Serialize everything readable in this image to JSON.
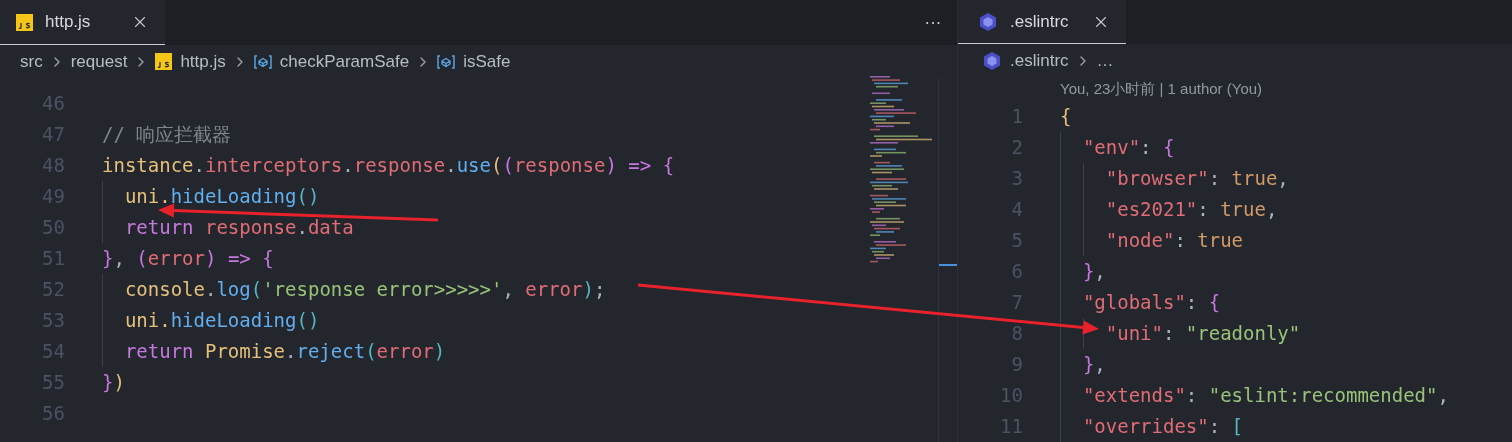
{
  "editors": [
    {
      "tab": {
        "label": "http.js",
        "selected": true
      },
      "more": "···",
      "breadcrumb": [
        {
          "kind": "folder",
          "label": "src"
        },
        {
          "kind": "folder",
          "label": "request"
        },
        {
          "kind": "file",
          "label": "http.js"
        },
        {
          "kind": "symbol",
          "label": "checkParamSafe"
        },
        {
          "kind": "symbol",
          "label": "isSafe"
        }
      ],
      "lines": [
        {
          "number": "46"
        },
        {
          "number": "47",
          "tokens": [
            {
              "kind": "cmt",
              "text": "// 响应拦截器"
            }
          ]
        },
        {
          "number": "48",
          "tokens": [
            {
              "kind": "cls",
              "text": "instance"
            },
            {
              "kind": "plain",
              "text": "."
            },
            {
              "kind": "var",
              "text": "interceptors"
            },
            {
              "kind": "plain",
              "text": "."
            },
            {
              "kind": "var",
              "text": "response"
            },
            {
              "kind": "plain",
              "text": "."
            },
            {
              "kind": "fn",
              "text": "use"
            },
            {
              "kind": "p1",
              "text": "("
            },
            {
              "kind": "p2",
              "text": "("
            },
            {
              "kind": "var",
              "text": "response"
            },
            {
              "kind": "p2",
              "text": ") "
            },
            {
              "kind": "kw",
              "text": "=> "
            },
            {
              "kind": "p2",
              "text": "{"
            }
          ]
        },
        {
          "number": "49",
          "tokens": [
            {
              "kind": "cls",
              "text": "  uni."
            },
            {
              "kind": "fn",
              "text": "hideLoading"
            },
            {
              "kind": "p3",
              "text": "()"
            }
          ]
        },
        {
          "number": "50",
          "tokens": [
            {
              "kind": "kw",
              "text": "  return "
            },
            {
              "kind": "var",
              "text": "response"
            },
            {
              "kind": "plain",
              "text": "."
            },
            {
              "kind": "var",
              "text": "data"
            }
          ]
        },
        {
          "number": "51",
          "tokens": [
            {
              "kind": "p2",
              "text": "}"
            },
            {
              "kind": "plain",
              "text": ", "
            },
            {
              "kind": "p2",
              "text": "("
            },
            {
              "kind": "var",
              "text": "error"
            },
            {
              "kind": "p2",
              "text": ") "
            },
            {
              "kind": "kw",
              "text": "=> "
            },
            {
              "kind": "p2",
              "text": "{"
            }
          ]
        },
        {
          "number": "52",
          "tokens": [
            {
              "kind": "cls",
              "text": "  console"
            },
            {
              "kind": "plain",
              "text": "."
            },
            {
              "kind": "fn",
              "text": "log"
            },
            {
              "kind": "p3",
              "text": "("
            },
            {
              "kind": "str",
              "text": "'response error>>>>>'"
            },
            {
              "kind": "plain",
              "text": ", "
            },
            {
              "kind": "var",
              "text": "error"
            },
            {
              "kind": "p3",
              "text": ")"
            },
            {
              "kind": "plain",
              "text": ";"
            }
          ]
        },
        {
          "number": "53",
          "tokens": [
            {
              "kind": "cls",
              "text": "  uni."
            },
            {
              "kind": "fn",
              "text": "hideLoading"
            },
            {
              "kind": "p3",
              "text": "()"
            }
          ]
        },
        {
          "number": "54",
          "tokens": [
            {
              "kind": "kw",
              "text": "  return "
            },
            {
              "kind": "cls",
              "text": "Promise"
            },
            {
              "kind": "plain",
              "text": "."
            },
            {
              "kind": "fn",
              "text": "reject"
            },
            {
              "kind": "p3",
              "text": "("
            },
            {
              "kind": "var",
              "text": "error"
            },
            {
              "kind": "p3",
              "text": ")"
            }
          ]
        },
        {
          "number": "55",
          "tokens": [
            {
              "kind": "p2",
              "text": "}"
            },
            {
              "kind": "p1",
              "text": ")"
            }
          ]
        },
        {
          "number": "56"
        }
      ]
    },
    {
      "tab": {
        "label": ".eslintrc",
        "selected": true
      },
      "breadcrumb": [
        {
          "kind": "file",
          "label": ".eslintrc"
        },
        {
          "kind": "ellipsis",
          "label": "…"
        }
      ],
      "codelens": "You, 23小时前 | 1 author (You)",
      "lines": [
        {
          "number": "1",
          "tokens": [
            {
              "kind": "p1",
              "text": "{"
            }
          ]
        },
        {
          "number": "2",
          "tokens": [
            {
              "kind": "var",
              "text": "  \"env\""
            },
            {
              "kind": "plain",
              "text": ": "
            },
            {
              "kind": "p2",
              "text": "{"
            }
          ]
        },
        {
          "number": "3",
          "tokens": [
            {
              "kind": "var",
              "text": "    \"browser\""
            },
            {
              "kind": "plain",
              "text": ": "
            },
            {
              "kind": "bool",
              "text": "true"
            },
            {
              "kind": "plain",
              "text": ","
            }
          ]
        },
        {
          "number": "4",
          "tokens": [
            {
              "kind": "var",
              "text": "    \"es2021\""
            },
            {
              "kind": "plain",
              "text": ": "
            },
            {
              "kind": "bool",
              "text": "true"
            },
            {
              "kind": "plain",
              "text": ","
            }
          ]
        },
        {
          "number": "5",
          "tokens": [
            {
              "kind": "var",
              "text": "    \"node\""
            },
            {
              "kind": "plain",
              "text": ": "
            },
            {
              "kind": "bool",
              "text": "true"
            }
          ]
        },
        {
          "number": "6",
          "tokens": [
            {
              "kind": "p2",
              "text": "  }"
            },
            {
              "kind": "plain",
              "text": ","
            }
          ]
        },
        {
          "number": "7",
          "tokens": [
            {
              "kind": "var",
              "text": "  \"globals\""
            },
            {
              "kind": "plain",
              "text": ": "
            },
            {
              "kind": "p2",
              "text": "{"
            }
          ]
        },
        {
          "number": "8",
          "tokens": [
            {
              "kind": "var",
              "text": "    \"uni\""
            },
            {
              "kind": "plain",
              "text": ": "
            },
            {
              "kind": "str",
              "text": "\"readonly\""
            }
          ]
        },
        {
          "number": "9",
          "tokens": [
            {
              "kind": "p2",
              "text": "  }"
            },
            {
              "kind": "plain",
              "text": ","
            }
          ]
        },
        {
          "number": "10",
          "tokens": [
            {
              "kind": "var",
              "text": "  \"extends\""
            },
            {
              "kind": "plain",
              "text": ": "
            },
            {
              "kind": "str",
              "text": "\"eslint:recommended\""
            },
            {
              "kind": "plain",
              "text": ","
            }
          ]
        },
        {
          "number": "11",
          "tokens": [
            {
              "kind": "var",
              "text": "  \"overrides\""
            },
            {
              "kind": "plain",
              "text": ": "
            },
            {
              "kind": "p3",
              "text": "["
            }
          ]
        }
      ]
    }
  ]
}
